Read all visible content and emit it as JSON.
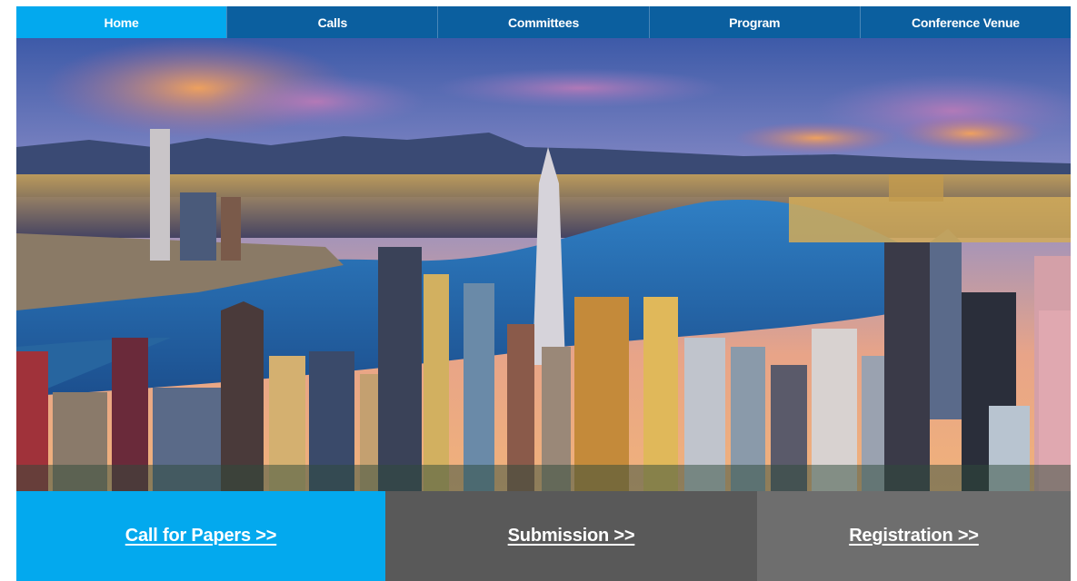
{
  "nav": {
    "items": [
      {
        "label": "Home",
        "active": true
      },
      {
        "label": "Calls",
        "active": false
      },
      {
        "label": "Committees",
        "active": false
      },
      {
        "label": "Program",
        "active": false
      },
      {
        "label": "Conference Venue",
        "active": false
      }
    ]
  },
  "hero": {
    "image": "hong-kong-skyline-photo"
  },
  "boxes": [
    {
      "label": "Call for Papers >>",
      "color": "#03a9ee"
    },
    {
      "label": "Submission >>",
      "color": "#595959"
    },
    {
      "label": "Registration >>",
      "color": "#6e6e6e"
    }
  ],
  "colors": {
    "nav_bg": "#0b5f9f",
    "accent": "#03a9ee"
  }
}
